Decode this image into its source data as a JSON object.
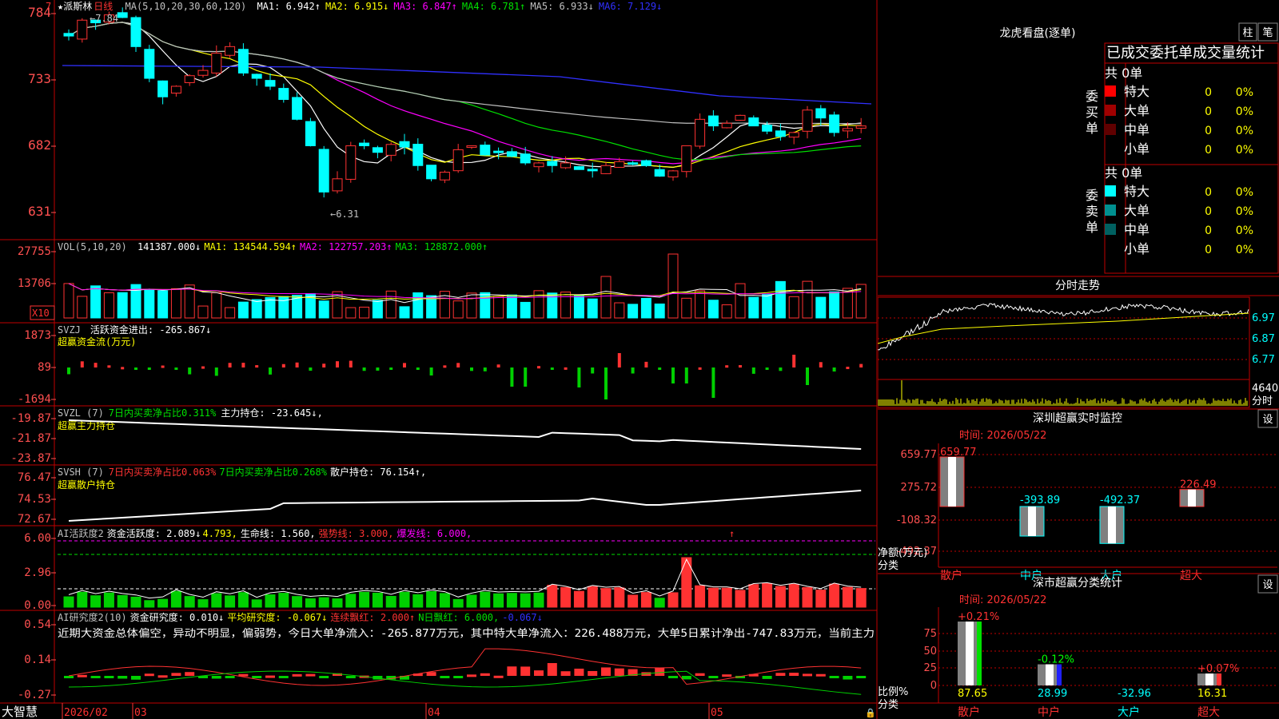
{
  "colors": {
    "up": "#ff3232",
    "down": "#00ffff",
    "grid": "#8b0000",
    "frame": "#c00000",
    "axis": "#ff5050",
    "white": "#ffffff",
    "yellow": "#ffff00",
    "magenta": "#ff00ff",
    "green": "#00e000",
    "blue": "#3030ff",
    "gray": "#c0c0c0",
    "darkgreen": "#00b000"
  },
  "main": {
    "star": "★",
    "stock_name": "派斯林",
    "period": "日线",
    "ma_title": "MA(5,10,20,30,60,120)",
    "ma": [
      {
        "label": "MA1: 6.942↑",
        "color": "#ffffff"
      },
      {
        "label": "MA2: 6.915↓",
        "color": "#ffff00"
      },
      {
        "label": "MA3: 6.847↑",
        "color": "#ff00ff"
      },
      {
        "label": "MA4: 6.781↑",
        "color": "#00e000"
      },
      {
        "label": "MA5: 6.933↓",
        "color": "#c0c0c0"
      },
      {
        "label": "MA6: 7.129↓",
        "color": "#3030ff"
      }
    ],
    "y_labels": [
      "784",
      "733",
      "682",
      "631"
    ],
    "high_note": "←7.84",
    "low_note": "←6.31",
    "top_marker": "7"
  },
  "vol": {
    "title": "VOL(5,10,20)",
    "value": "141387.000↓",
    "ma1": "MA1: 134544.594↑",
    "ma2": "MA2: 122757.203↑",
    "ma3": "MA3: 128872.000↑",
    "y_labels": [
      "27755",
      "13706"
    ],
    "unit": "X10"
  },
  "svzj": {
    "title": "SVZJ",
    "label": "活跃资金进出: -265.867↓",
    "sub": "超赢资金流(万元)",
    "y_labels": [
      "1873",
      "89",
      "-1694"
    ]
  },
  "svzl": {
    "title": "SVZL (7)",
    "ratio": "7日内买卖净占比0.311%",
    "hold": "主力持仓: -23.645↓,",
    "sub": "超赢主力持仓",
    "y_labels": [
      "-19.87",
      "-21.87",
      "-23.87"
    ]
  },
  "svsh": {
    "title": "SVSH (7)",
    "ratio1": "7日内买卖净占比0.063%",
    "ratio2": "7日内买卖净占比0.268%",
    "hold": "散户持仓: 76.154↑,",
    "sub": "超赢散户持仓",
    "y_labels": [
      "76.47",
      "74.53",
      "72.67"
    ]
  },
  "ai1": {
    "title": "AI活跃度2",
    "l1": "资金活跃度: 2.089↓",
    "l2": "4.793,",
    "l3": "生命线: 1.560,",
    "l4": "强势线: 3.000,",
    "l5": "爆发线: 6.000,",
    "y_labels": [
      "6.00",
      "2.96",
      "0.00"
    ]
  },
  "ai2": {
    "title": "AI研究度2(10)",
    "l1": "资金研究度: 0.010↓",
    "l2": "平均研究度: -0.067↓",
    "l3": "连续飘红: 2.000↑",
    "l4": "N日飘红: 6.000,",
    "l5": "-0.067↓",
    "desc": "近期大资金总体偏空，异动不明显，偏弱势，今日大单净流入：-265.877万元，其中特大单净流入：226.488万元，大单5日累计净出-747.83万元，当前主力",
    "y_labels": [
      "0.54",
      "0.14",
      "-0.27"
    ]
  },
  "bottom": {
    "brand": "大智慧",
    "dates": [
      "2026/02",
      "03",
      "04",
      "05"
    ]
  },
  "lhb": {
    "title": "龙虎看盘(逐单)",
    "btn1": "柱",
    "btn2": "笔",
    "header": "已成交委托单成交量统计",
    "buy_label": "委买单",
    "sell_label": "委卖单",
    "buy_total": "共 0单",
    "sell_total": "共 0单",
    "buy_rows": [
      {
        "name": "特大",
        "v": "0",
        "p": "0%",
        "c": "#ff0000"
      },
      {
        "name": "大单",
        "v": "0",
        "p": "0%",
        "c": "#a00000"
      },
      {
        "name": "中单",
        "v": "0",
        "p": "0%",
        "c": "#600000"
      },
      {
        "name": "小单",
        "v": "0",
        "p": "0%",
        "c": ""
      }
    ],
    "sell_rows": [
      {
        "name": "特大",
        "v": "0",
        "p": "0%",
        "c": "#00ffff"
      },
      {
        "name": "大单",
        "v": "0",
        "p": "0%",
        "c": "#009090"
      },
      {
        "name": "中单",
        "v": "0",
        "p": "0%",
        "c": "#006060"
      },
      {
        "name": "小单",
        "v": "0",
        "p": "0%",
        "c": ""
      }
    ]
  },
  "fenshi": {
    "title": "分时走势",
    "y_labels": [
      "6.97",
      "6.87",
      "6.77"
    ],
    "vol_label": "4640",
    "vol_unit": "分时"
  },
  "sz_monitor": {
    "title": "深圳超赢实时监控",
    "set": "设",
    "time": "时间: 2026/05/22",
    "y_labels": [
      "659.77",
      "275.72",
      "-108.32",
      "-492.37"
    ],
    "unit": "净额(万元)",
    "cat_label": "分类",
    "bars": [
      {
        "name": "散户",
        "v": 659.77,
        "label": "659.77"
      },
      {
        "name": "中户",
        "v": -393.89,
        "label": "-393.89"
      },
      {
        "name": "大户",
        "v": -492.37,
        "label": "-492.37"
      },
      {
        "name": "超大",
        "v": 226.49,
        "label": "226.49"
      }
    ]
  },
  "sz_class": {
    "title": "深市超赢分类统计",
    "set": "设",
    "time": "时间: 2026/05/22",
    "y_labels": [
      "75",
      "50",
      "25",
      "0"
    ],
    "unit": "比例%",
    "cat_label": "分类",
    "bars": [
      {
        "name": "散户",
        "top": "+0.21%",
        "val": 87.65,
        "bottom": "87.65"
      },
      {
        "name": "中户",
        "top": "-0.12%",
        "val": 28.99,
        "bottom": "28.99"
      },
      {
        "name": "大户",
        "top": "",
        "val": -32.96,
        "bottom": "-32.96"
      },
      {
        "name": "超大",
        "top": "+0.07%",
        "val": 16.31,
        "bottom": "16.31"
      }
    ]
  }
}
